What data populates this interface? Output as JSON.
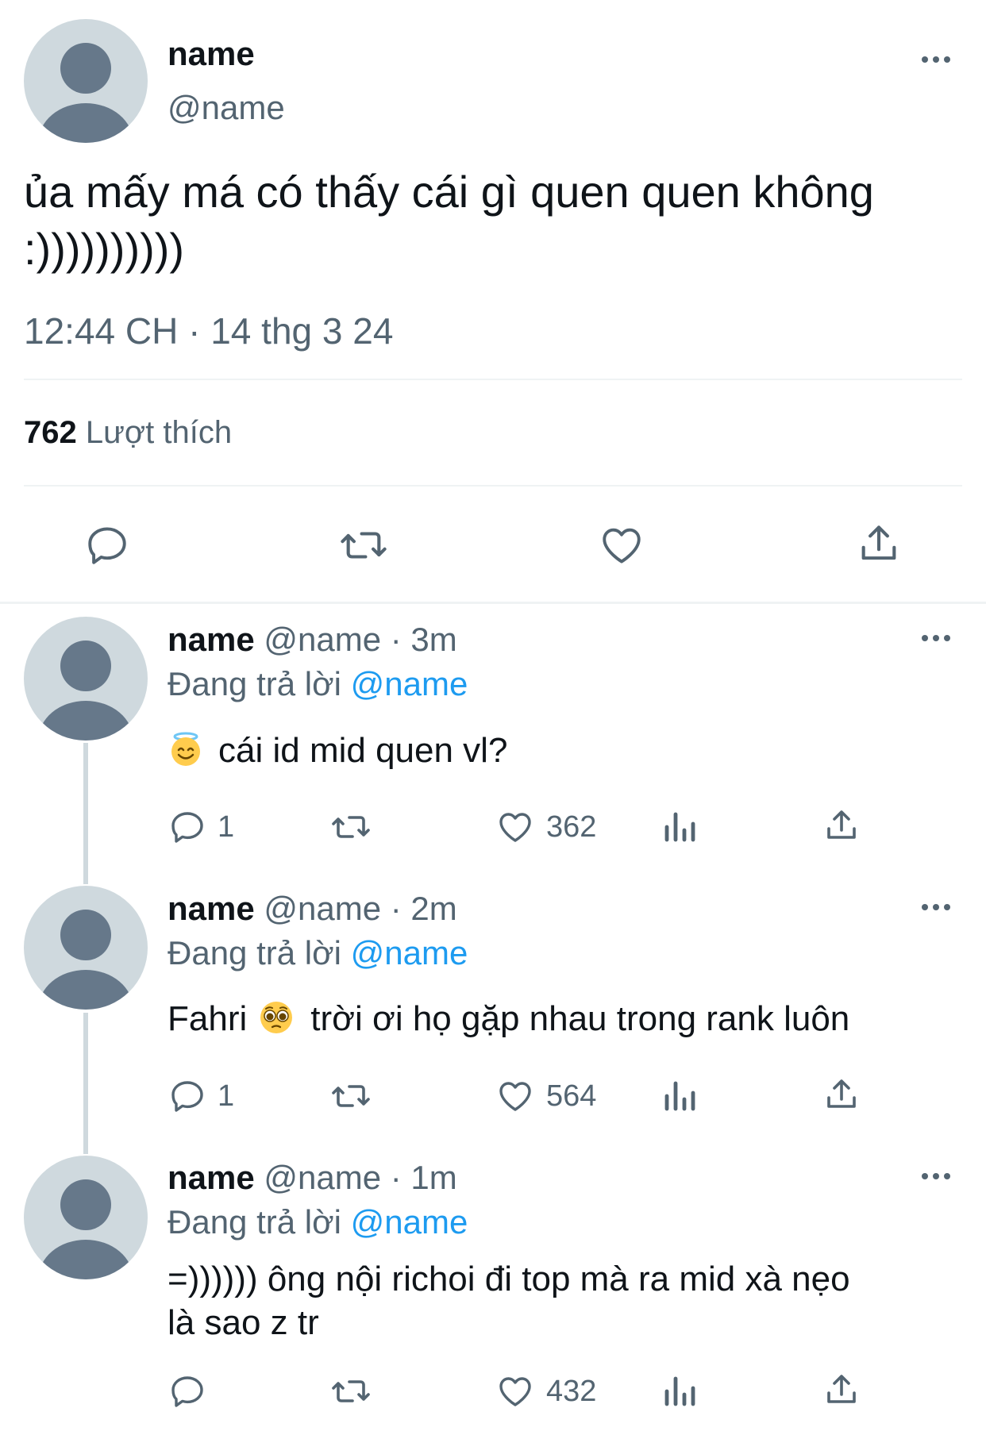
{
  "main_tweet": {
    "name": "name",
    "handle": "@name",
    "text_line1": "ủa mấy má có thấy cái gì quen quen không",
    "text_line2": ":))))))))))",
    "timestamp": "12:44 CH · 14 thg 3 24",
    "like_count": "762",
    "like_label": "Lượt thích"
  },
  "replies": [
    {
      "name": "name",
      "handle": "@name",
      "time": "· 3m",
      "replying_prefix": "Đang trả lời",
      "replying_to": "@name",
      "emoji": "smiling-face-with-halo",
      "text": "cái id mid quen vl?",
      "reply_count": "1",
      "like_count": "362"
    },
    {
      "name": "name",
      "handle": "@name",
      "time": "· 2m",
      "replying_prefix": "Đang trả lời",
      "replying_to": "@name",
      "text_before": "Fahri",
      "emoji": "pleading-face",
      "text_after": "trời ơi họ gặp nhau trong rank luôn",
      "reply_count": "1",
      "like_count": "564"
    },
    {
      "name": "name",
      "handle": "@name",
      "time": "· 1m",
      "replying_prefix": "Đang trả lời",
      "replying_to": "@name",
      "text_line1": "=)))))) ông nội richoi đi top mà ra mid xà nẹo",
      "text_line2": "là sao z tr",
      "reply_count": "",
      "like_count": "432"
    }
  ],
  "colors": {
    "text": "#0f1419",
    "muted": "#536471",
    "link": "#1d9bf0",
    "avatar_bg": "#cfd9de",
    "avatar_fg": "#66788a",
    "divider": "#eff3f4"
  }
}
